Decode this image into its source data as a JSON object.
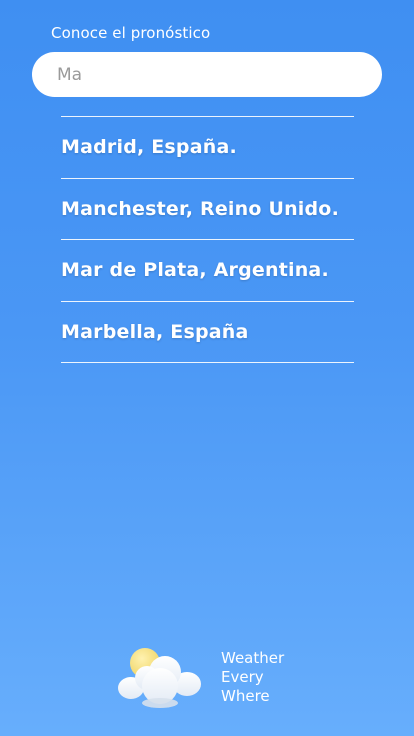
{
  "search": {
    "label": "Conoce el pronóstico",
    "value": "Ma"
  },
  "results": [
    {
      "label": "Madrid, España."
    },
    {
      "label": "Manchester, Reino Unido."
    },
    {
      "label": "Mar de Plata, Argentina."
    },
    {
      "label": "Marbella, España"
    }
  ],
  "brand": {
    "line1": "Weather",
    "line2": "Every",
    "line3": "Where",
    "icon": "sun-cloud-icon"
  },
  "colors": {
    "background_top": "#3f8ff2",
    "background_bottom": "#67aefc",
    "text": "#ffffff",
    "input_text": "#9a9a9a",
    "sun": "#f7e08a"
  }
}
